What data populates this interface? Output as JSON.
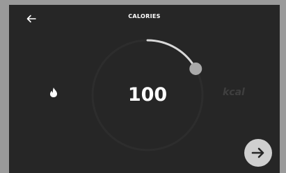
{
  "header": {
    "title": "CALORIES",
    "back_icon": "arrow-left-icon"
  },
  "dial": {
    "value": "100",
    "unit": "kcal",
    "icon": "flame-icon",
    "progress_fraction": 0.17,
    "colors": {
      "track": "#2d2d2d",
      "progress": "#d9d9d9",
      "handle": "#a9a9a9"
    }
  },
  "footer": {
    "next_icon": "arrow-right-icon"
  },
  "colors": {
    "background": "#262626",
    "frame": "#9a9a9a",
    "next_button_bg": "#cfcfcf",
    "unit_text": "#3f3f3f"
  }
}
